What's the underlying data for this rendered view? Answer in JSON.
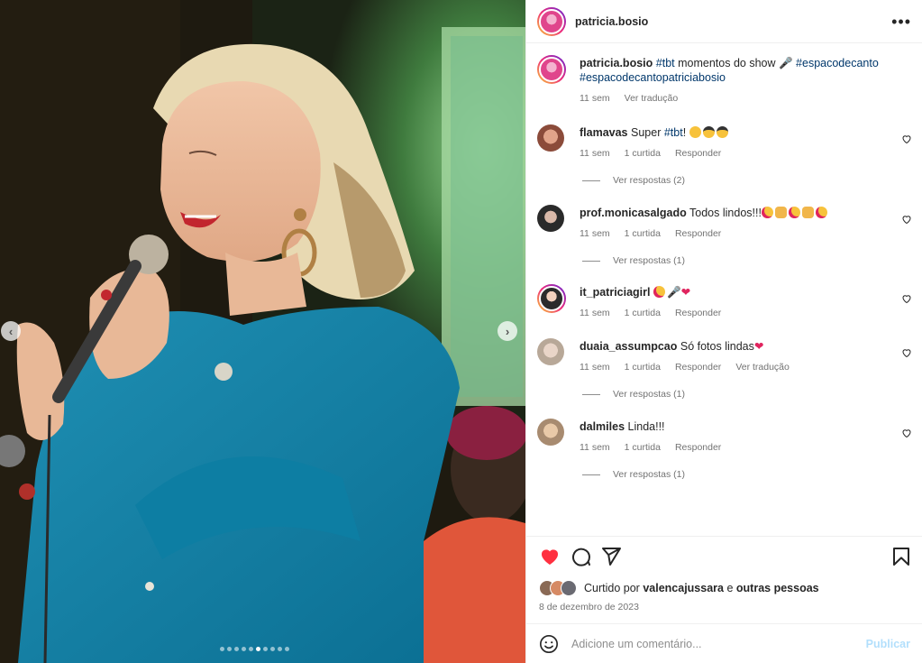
{
  "post": {
    "username": "patricia.bosio",
    "caption": {
      "text_1": "momentos do show",
      "tag_1": "#tbt",
      "tag_2": "#espacodecanto",
      "tag_3": "#espacodecantopatriciabosio",
      "time": "11 sem",
      "translate": "Ver tradução"
    },
    "carousel": {
      "slide_count": 10,
      "active_index": 5
    }
  },
  "comments": [
    {
      "user": "flamavas",
      "text": "Super",
      "tag": "#tbt",
      "text_after": "!",
      "emojis": [
        "slightly-smiling-face",
        "sunglasses-face",
        "sunglasses-face"
      ],
      "time": "11 sem",
      "likes": "1 curtida",
      "reply": "Responder",
      "replies": "Ver respostas (2)"
    },
    {
      "user": "prof.monicasalgado",
      "text": "Todos lindos!!!",
      "emojis": [
        "heart-eyes",
        "clapping-hands",
        "heart-eyes",
        "clapping-hands",
        "heart-eyes"
      ],
      "time": "11 sem",
      "likes": "1 curtida",
      "reply": "Responder",
      "replies": "Ver respostas (1)"
    },
    {
      "user": "it_patriciagirl",
      "text": "",
      "emojis": [
        "heart-eyes",
        "microphone",
        "red-heart"
      ],
      "time": "11 sem",
      "likes": "1 curtida",
      "reply": "Responder"
    },
    {
      "user": "duaia_assumpcao",
      "text": "Só fotos lindas",
      "emojis": [
        "red-heart"
      ],
      "time": "11 sem",
      "likes": "1 curtida",
      "reply": "Responder",
      "translate": "Ver tradução",
      "replies": "Ver respostas (1)"
    },
    {
      "user": "dalmiles",
      "text": "Linda!!!",
      "emojis": [],
      "time": "11 sem",
      "likes": "1 curtida",
      "reply": "Responder",
      "replies": "Ver respostas (1)"
    }
  ],
  "actions": {
    "liked_by_prefix": "Curtido por",
    "liked_by_user": "valencajussara",
    "liked_by_conj": "e",
    "liked_by_others": "outras pessoas",
    "date": "8 de dezembro de 2023",
    "like_color": "#ff3040"
  },
  "add_comment": {
    "placeholder": "Adicione um comentário...",
    "publish": "Publicar"
  }
}
